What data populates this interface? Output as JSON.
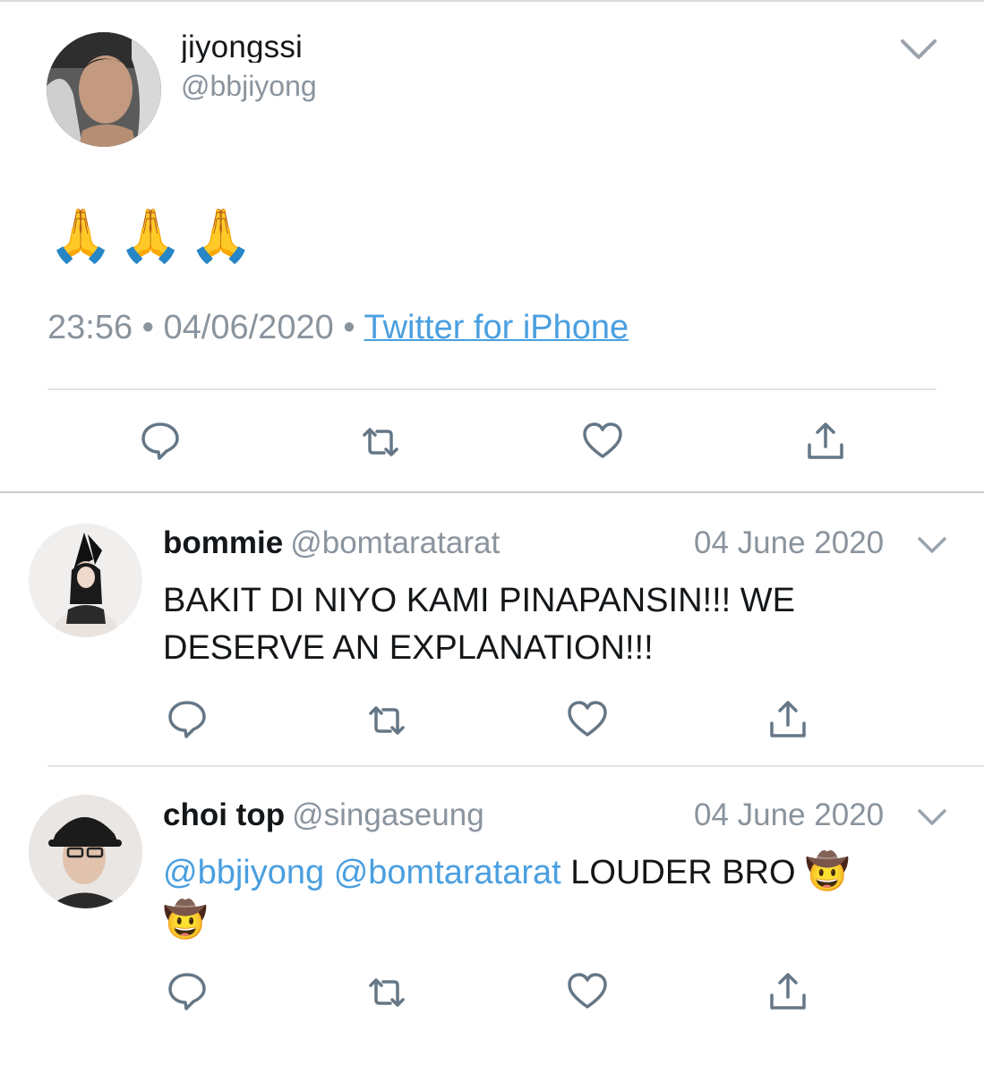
{
  "main_tweet": {
    "display_name": "jiyongssi",
    "handle": "@bbjiyong",
    "text_emojis": [
      "🙏",
      "🙏",
      "🙏"
    ],
    "time": "23:56",
    "date": "04/06/2020",
    "source": "Twitter for iPhone",
    "dot": "•"
  },
  "replies": [
    {
      "display_name": "bommie",
      "handle": "@bomtaratarat",
      "date": "04 June 2020",
      "text": "BAKIT DI NIYO KAMI PINAPANSIN!!! WE DESERVE AN EXPLANATION!!!"
    },
    {
      "display_name": "choi top",
      "handle": "@singaseung",
      "date": "04 June 2020",
      "mention_1": "@bbjiyong",
      "mention_2": "@bomtaratarat",
      "text": "LOUDER BRO",
      "emojis": [
        "🤠",
        "🤠"
      ]
    }
  ],
  "icons": [
    "reply-icon",
    "retweet-icon",
    "like-icon",
    "share-icon",
    "chevron-down-icon"
  ],
  "colors": {
    "link": "#4a9fe0",
    "muted": "#8a949e",
    "icon": "#657786",
    "text": "#14171a"
  }
}
